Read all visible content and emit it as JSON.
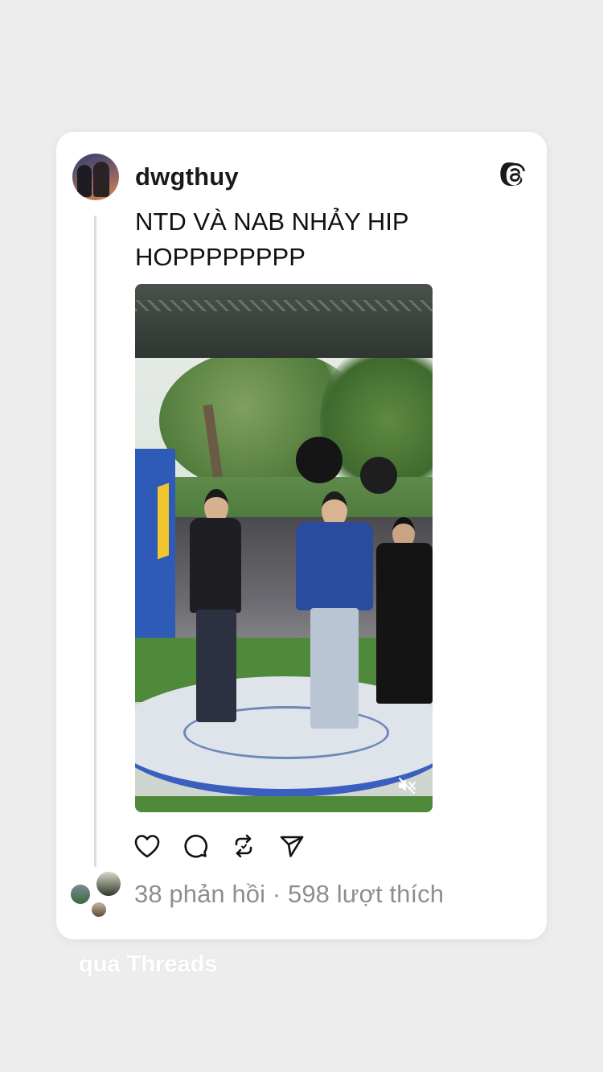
{
  "post": {
    "username": "dwgthuy",
    "text": "NTD VÀ NAB NHẢY HIP HOPPPPPPPP",
    "media_muted_icon": "speaker-muted-icon",
    "stats": "38 phản hồi · 598 lượt thích"
  },
  "actions": {
    "icons": [
      "heart-icon",
      "comment-icon",
      "repost-icon",
      "share-icon"
    ]
  },
  "brand_icon": "threads-logo-icon",
  "footer": {
    "via": "qua Threads"
  },
  "colors": {
    "background": "#ededed",
    "card": "#ffffff",
    "text": "#111111",
    "muted_text": "#8e8e8e"
  }
}
